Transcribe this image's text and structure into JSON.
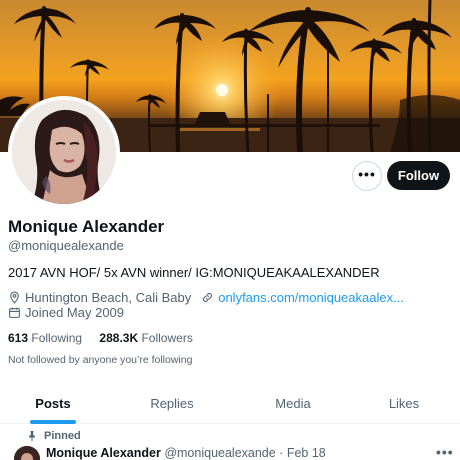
{
  "profile": {
    "name": "Monique Alexander",
    "handle": "@moniquealexande",
    "bio": "2017 AVN HOF/ 5x AVN winner/ IG:MONIQUEAKAALEXANDER",
    "location": "Huntington Beach, Cali Baby",
    "website": "onlyfans.com/moniqueakaalex...",
    "joined": "Joined May 2009",
    "following_count": "613",
    "following_label": "Following",
    "followers_count": "288.3K",
    "followers_label": "Followers",
    "not_followed": "Not followed by anyone you’re following"
  },
  "actions": {
    "more_label": "•••",
    "follow_label": "Follow"
  },
  "tabs": [
    {
      "label": "Posts",
      "active": true
    },
    {
      "label": "Replies",
      "active": false
    },
    {
      "label": "Media",
      "active": false
    },
    {
      "label": "Likes",
      "active": false
    }
  ],
  "pinned_tweet": {
    "pinned_label": "Pinned",
    "name": "Monique Alexander",
    "handle_date": "@moniquealexande · Feb 18",
    "more_label": "•••"
  },
  "icons": {
    "location": "map-pin-icon",
    "link": "link-icon",
    "calendar": "calendar-icon",
    "pin": "pin-icon",
    "more": "more-icon"
  },
  "colors": {
    "accent": "#1d9bf0",
    "text": "#0f1419",
    "muted": "#536471",
    "follow_button": "#0f1419"
  }
}
